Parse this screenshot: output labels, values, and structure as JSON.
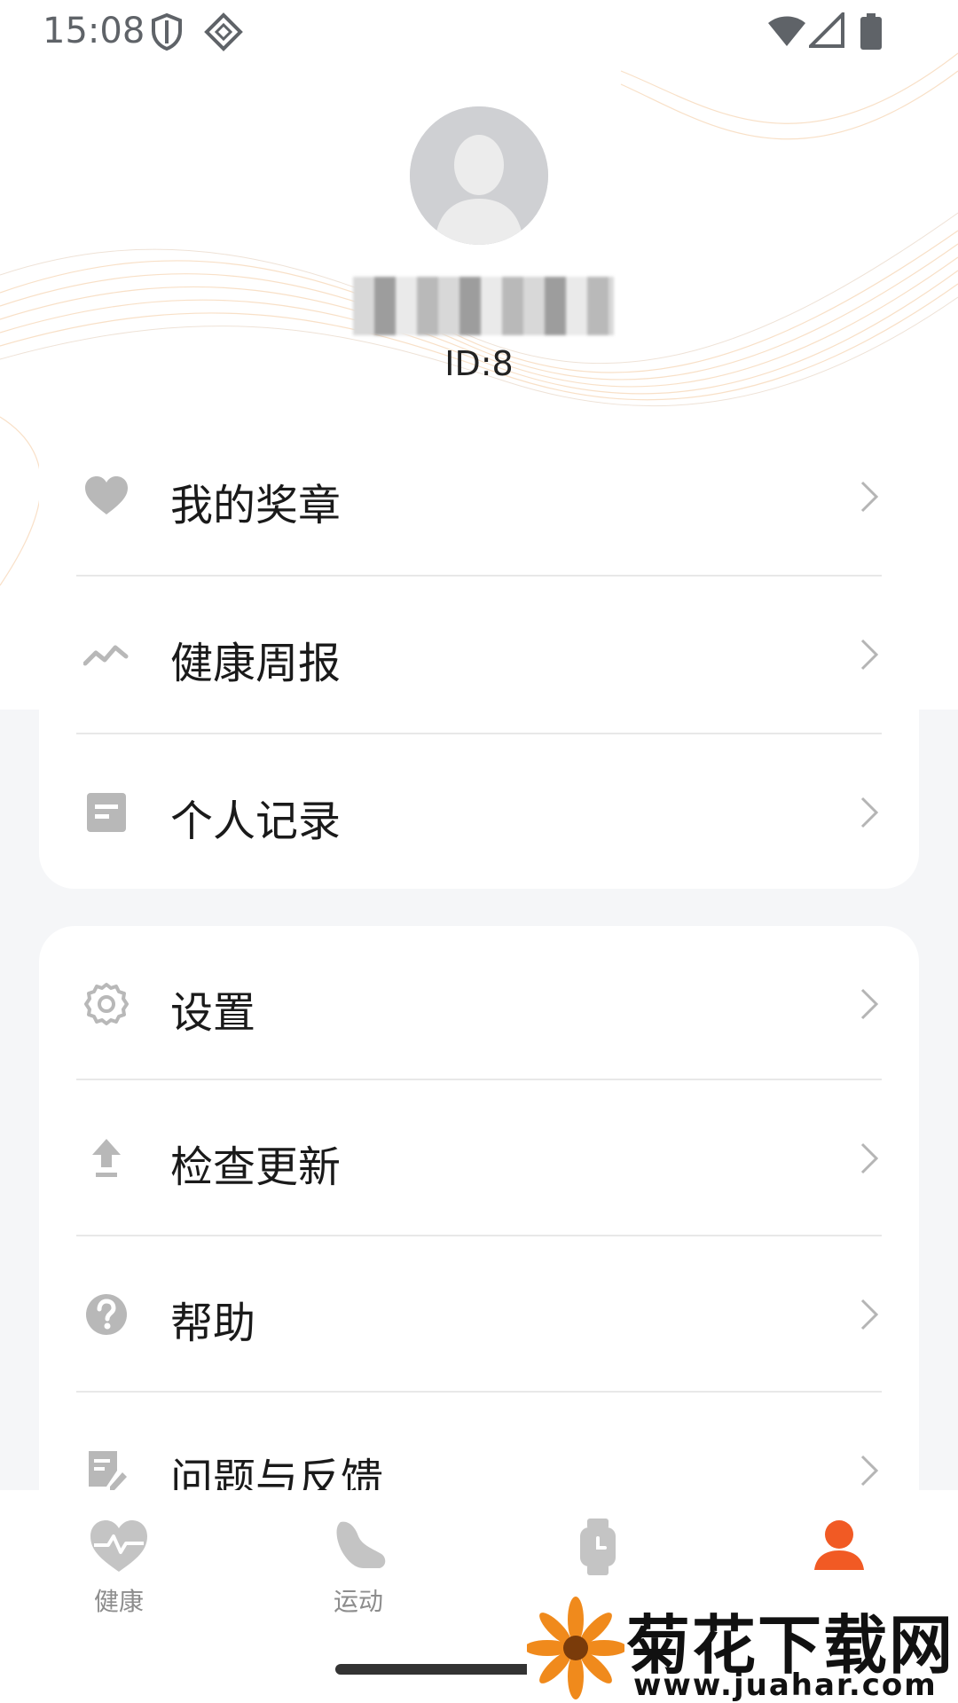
{
  "status_bar": {
    "time": "15:08"
  },
  "profile": {
    "user_id": "ID:8"
  },
  "menu_group_1": [
    {
      "label": "我的奖章",
      "icon": "heart-icon"
    },
    {
      "label": "健康周报",
      "icon": "trend-line-icon"
    },
    {
      "label": "个人记录",
      "icon": "document-icon"
    }
  ],
  "menu_group_2": [
    {
      "label": "设置",
      "icon": "gear-icon"
    },
    {
      "label": "检查更新",
      "icon": "upload-arrow-icon"
    },
    {
      "label": "帮助",
      "icon": "help-circle-icon"
    },
    {
      "label": "问题与反馈",
      "icon": "feedback-edit-icon"
    }
  ],
  "bottom_nav": [
    {
      "label": "健康",
      "icon": "heart-pulse-icon"
    },
    {
      "label": "运动",
      "icon": "shoe-icon"
    },
    {
      "label": "",
      "icon": "watch-icon"
    },
    {
      "label": "",
      "icon": "person-icon",
      "active": true
    }
  ],
  "colors": {
    "accent": "#f15a24",
    "icon_gray": "#b8b8b8",
    "nav_gray": "#c4c4c4"
  },
  "watermark": {
    "title": "菊花下载网",
    "url": "www.juahar.com"
  }
}
